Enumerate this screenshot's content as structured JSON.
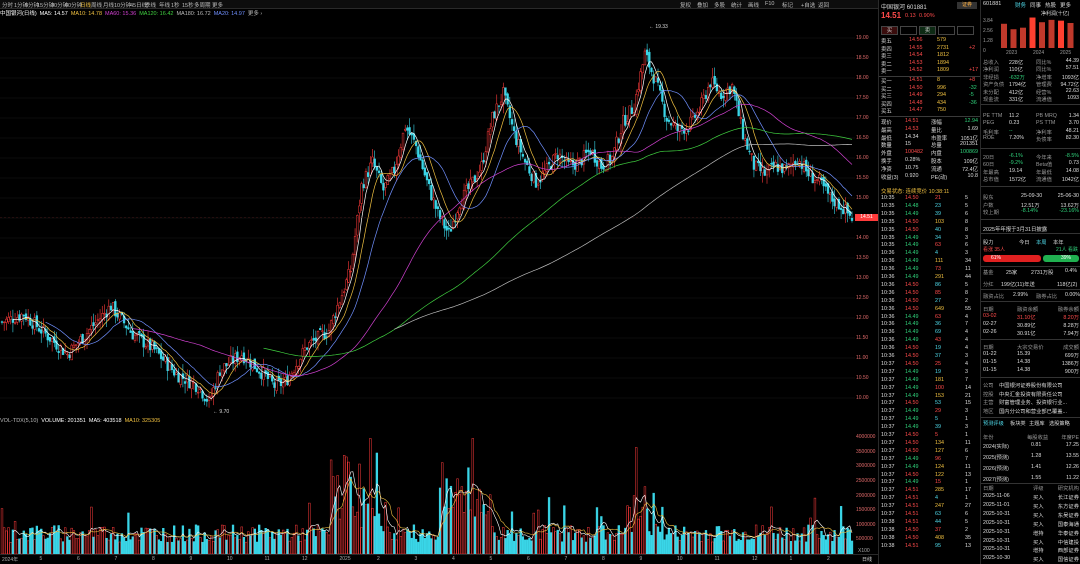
{
  "toolbar": {
    "periods": [
      {
        "label": "分时",
        "active": false
      },
      {
        "label": "1分钟",
        "active": false
      },
      {
        "label": "5分钟",
        "active": false
      },
      {
        "label": "15分钟",
        "active": false
      },
      {
        "label": "30分钟",
        "active": false
      },
      {
        "label": "60分钟",
        "active": false
      },
      {
        "label": "日线",
        "active": true
      },
      {
        "label": "周线",
        "active": false
      },
      {
        "label": "月线",
        "active": false
      },
      {
        "label": "10分钟",
        "active": false
      },
      {
        "label": "45日线",
        "active": false
      },
      {
        "label": "季线",
        "active": false
      },
      {
        "label": "年线",
        "active": false
      },
      {
        "label": "1秒",
        "active": false
      },
      {
        "label": "15秒",
        "active": false
      },
      {
        "label": "多周期",
        "active": false
      },
      {
        "label": "更多",
        "active": false
      }
    ],
    "tools": [
      "复权",
      "叠加",
      "多股",
      "统计",
      "画线",
      "F10",
      "标记",
      "+自选",
      "返回"
    ]
  },
  "ma_legend": {
    "title": "中国银河(日线)",
    "items": [
      {
        "text": "MA5: 14.57",
        "color": "#ffffff"
      },
      {
        "text": "MA10: 14.78",
        "color": "#f0c040"
      },
      {
        "text": "MA60: 15.36",
        "color": "#d040d0"
      },
      {
        "text": "MA120: 16.42",
        "color": "#40d040"
      },
      {
        "text": "MA180: 16.72",
        "color": "#bbbbbb"
      },
      {
        "text": "MA20: 14.97",
        "color": "#7090ff"
      },
      {
        "text": "更多 ›",
        "color": "#bbbbbb"
      }
    ]
  },
  "chart_data": [
    {
      "type": "candlestick",
      "title": "中国银河(日线)",
      "ylim": [
        9.5,
        19.5
      ],
      "y_ticks": [
        "18.00",
        "17.50",
        "17.00",
        "16.50",
        "16.00",
        "15.50",
        "15.00",
        "14.50",
        "14.00",
        "13.50",
        "13.00",
        "12.50",
        "12.00",
        "11.50",
        "11.00",
        "10.50",
        "10.00"
      ],
      "extra_ticks": [
        "19.00",
        "18.50"
      ],
      "x_labels": [
        "2024年",
        "5",
        "6",
        "7",
        "8",
        "9",
        "10",
        "11",
        "12",
        "2025",
        "2",
        "3",
        "4",
        "5",
        "6",
        "7",
        "8",
        "9",
        "10",
        "11",
        "12",
        "1",
        "2"
      ],
      "annotations": [
        {
          "text": "19.33"
        },
        {
          "text": "9.70"
        }
      ],
      "trend": [
        [
          0,
          11.9
        ],
        [
          10,
          12.1
        ],
        [
          20,
          11.6
        ],
        [
          30,
          11.1
        ],
        [
          40,
          11.7
        ],
        [
          50,
          12.3
        ],
        [
          60,
          11.6
        ],
        [
          70,
          11.2
        ],
        [
          80,
          10.6
        ],
        [
          90,
          10.3
        ],
        [
          95,
          9.9
        ],
        [
          100,
          10.7
        ],
        [
          110,
          11.1
        ],
        [
          120,
          10.6
        ],
        [
          125,
          10.3
        ],
        [
          130,
          10.4
        ],
        [
          140,
          11.3
        ],
        [
          150,
          11.7
        ],
        [
          160,
          13.2
        ],
        [
          165,
          15.3
        ],
        [
          170,
          15.9
        ],
        [
          175,
          15.2
        ],
        [
          180,
          15.7
        ],
        [
          185,
          16.8
        ],
        [
          190,
          16.3
        ],
        [
          195,
          15.4
        ],
        [
          200,
          14.6
        ],
        [
          205,
          14.1
        ],
        [
          210,
          14.9
        ],
        [
          215,
          15.3
        ],
        [
          220,
          15.8
        ],
        [
          225,
          17.0
        ],
        [
          230,
          17.6
        ],
        [
          235,
          16.6
        ],
        [
          240,
          15.9
        ],
        [
          245,
          15.4
        ],
        [
          250,
          15.7
        ],
        [
          255,
          16.1
        ],
        [
          260,
          15.8
        ],
        [
          265,
          15.9
        ],
        [
          270,
          16.2
        ],
        [
          275,
          15.8
        ],
        [
          280,
          16.0
        ],
        [
          285,
          16.9
        ],
        [
          290,
          17.3
        ],
        [
          295,
          18.6
        ],
        [
          300,
          17.9
        ],
        [
          305,
          17.0
        ],
        [
          310,
          16.7
        ],
        [
          315,
          16.8
        ],
        [
          320,
          17.2
        ],
        [
          325,
          17.9
        ],
        [
          330,
          17.6
        ],
        [
          335,
          17.8
        ],
        [
          340,
          16.6
        ],
        [
          345,
          15.8
        ],
        [
          350,
          15.6
        ],
        [
          355,
          15.8
        ],
        [
          360,
          15.7
        ],
        [
          365,
          16.0
        ],
        [
          370,
          15.6
        ],
        [
          375,
          15.4
        ],
        [
          380,
          15.0
        ],
        [
          385,
          14.8
        ],
        [
          390,
          14.5
        ]
      ],
      "last_value": 14.51,
      "series": [
        {
          "name": "MA5"
        },
        {
          "name": "MA10"
        },
        {
          "name": "MA20"
        },
        {
          "name": "MA60"
        },
        {
          "name": "MA120"
        },
        {
          "name": "MA180"
        }
      ]
    },
    {
      "type": "bar",
      "title": "VOL-TDX(5,10)",
      "ylim": [
        0,
        4000000
      ],
      "y_ticks": [
        "4000000",
        "3500000",
        "3000000",
        "2500000",
        "2000000",
        "1500000",
        "1000000",
        "500000"
      ],
      "unit": "X100",
      "values_note": "daily volume"
    }
  ],
  "vol_legend": {
    "items": [
      {
        "text": "VOL-TDX(5,10)",
        "color": "#bbbbbb"
      },
      {
        "text": "VOLUME: 201351",
        "color": "#ffffff"
      },
      {
        "text": "MA5: 403518",
        "color": "#ffffff"
      },
      {
        "text": "MA10: 325305",
        "color": "#f0c040"
      }
    ]
  },
  "quote": {
    "name": "中国银河",
    "code": "601881",
    "price": "14.51",
    "change": "0.13",
    "pct": "0.90%",
    "tag": "证券",
    "buy_btn": "买",
    "sell_btn": "卖",
    "sells": [
      {
        "l": "卖五",
        "p": "14.56",
        "v": "579",
        "d": ""
      },
      {
        "l": "卖四",
        "p": "14.55",
        "v": "2731",
        "d": "+2"
      },
      {
        "l": "卖三",
        "p": "14.54",
        "v": "1812",
        "d": ""
      },
      {
        "l": "卖二",
        "p": "14.53",
        "v": "1894",
        "d": ""
      },
      {
        "l": "卖一",
        "p": "14.52",
        "v": "1809",
        "d": "+17"
      }
    ],
    "buys": [
      {
        "l": "买一",
        "p": "14.51",
        "v": "8",
        "d": "+8"
      },
      {
        "l": "买二",
        "p": "14.50",
        "v": "996",
        "d": "-32"
      },
      {
        "l": "买三",
        "p": "14.49",
        "v": "294",
        "d": "-5"
      },
      {
        "l": "买四",
        "p": "14.48",
        "v": "434",
        "d": "-36"
      },
      {
        "l": "买五",
        "p": "14.47",
        "v": "750",
        "d": ""
      }
    ],
    "stats": [
      {
        "a": "现价",
        "av": "14.51",
        "b": "涨幅",
        "bv": "12.94"
      },
      {
        "a": "最高",
        "av": "14.53",
        "b": "量比",
        "bv": "1.69"
      },
      {
        "a": "最低",
        "av": "14.34",
        "b": "市盈率",
        "bv": "1051亿"
      },
      {
        "a": "数量",
        "av": "15",
        "b": "总量",
        "bv": "201351"
      },
      {
        "a": "外盘",
        "av": "100482",
        "b": "内盘",
        "bv": "100869"
      },
      {
        "a": "换手",
        "av": "0.28%",
        "b": "股本",
        "bv": "109亿"
      },
      {
        "a": "净资",
        "av": "10.75",
        "b": "流通",
        "bv": "72.4亿"
      },
      {
        "a": "收益(3)",
        "av": "0.920",
        "b": "PE(动)",
        "bv": "10.8"
      }
    ],
    "trade_title": "交易状态: 连续竞价 10:38:11",
    "ticks": [
      [
        "10:35",
        "14.50",
        "21",
        "5"
      ],
      [
        "10:35",
        "14.48",
        "23",
        "5"
      ],
      [
        "10:35",
        "14.49",
        "39",
        "6"
      ],
      [
        "10:35",
        "14.50",
        "103",
        "8"
      ],
      [
        "10:35",
        "14.50",
        "40",
        "8"
      ],
      [
        "10:35",
        "14.49",
        "34",
        "3"
      ],
      [
        "10:35",
        "14.49",
        "63",
        "6"
      ],
      [
        "10:36",
        "14.49",
        "4",
        "3"
      ],
      [
        "10:36",
        "14.49",
        "111",
        "34"
      ],
      [
        "10:36",
        "14.49",
        "73",
        "11"
      ],
      [
        "10:36",
        "14.49",
        "291",
        "44"
      ],
      [
        "10:36",
        "14.50",
        "86",
        "5"
      ],
      [
        "10:36",
        "14.50",
        "85",
        "8"
      ],
      [
        "10:36",
        "14.50",
        "27",
        "2"
      ],
      [
        "10:36",
        "14.50",
        "649",
        "55"
      ],
      [
        "10:36",
        "14.49",
        "63",
        "4"
      ],
      [
        "10:36",
        "14.49",
        "36",
        "7"
      ],
      [
        "10:36",
        "14.49",
        "69",
        "4"
      ],
      [
        "10:36",
        "14.49",
        "43",
        "4"
      ],
      [
        "10:36",
        "14.50",
        "19",
        "4"
      ],
      [
        "10:36",
        "14.50",
        "37",
        "3"
      ],
      [
        "10:37",
        "14.50",
        "25",
        "4"
      ],
      [
        "10:37",
        "14.49",
        "19",
        "3"
      ],
      [
        "10:37",
        "14.49",
        "181",
        "7"
      ],
      [
        "10:37",
        "14.49",
        "100",
        "14"
      ],
      [
        "10:37",
        "14.49",
        "153",
        "21"
      ],
      [
        "10:37",
        "14.50",
        "53",
        "15"
      ],
      [
        "10:37",
        "14.49",
        "29",
        "3"
      ],
      [
        "10:37",
        "14.49",
        "5",
        "1"
      ],
      [
        "10:37",
        "14.49",
        "39",
        "3"
      ],
      [
        "10:37",
        "14.50",
        "5",
        "1"
      ],
      [
        "10:37",
        "14.50",
        "134",
        "11"
      ],
      [
        "10:37",
        "14.50",
        "127",
        "6"
      ],
      [
        "10:37",
        "14.49",
        "96",
        "7"
      ],
      [
        "10:37",
        "14.49",
        "124",
        "11"
      ],
      [
        "10:37",
        "14.50",
        "122",
        "13"
      ],
      [
        "10:37",
        "14.49",
        "15",
        "1"
      ],
      [
        "10:37",
        "14.51",
        "285",
        "17"
      ],
      [
        "10:37",
        "14.51",
        "4",
        "1"
      ],
      [
        "10:37",
        "14.51",
        "247",
        "27"
      ],
      [
        "10:37",
        "14.51",
        "63",
        "6"
      ],
      [
        "10:38",
        "14.51",
        "44",
        "5"
      ],
      [
        "10:38",
        "14.50",
        "37",
        "2"
      ],
      [
        "10:38",
        "14.50",
        "408",
        "35"
      ],
      [
        "10:38",
        "14.51",
        "95",
        "13"
      ]
    ]
  },
  "info": {
    "code": "601881",
    "tabs": [
      "财务",
      "同事",
      "热股",
      "更多"
    ],
    "chart_title": "净利润(十亿)",
    "bar_years": [
      "2023",
      "2024",
      "2025"
    ],
    "bar_ticks": [
      "3.84",
      "2.56",
      "1.28",
      "0"
    ],
    "bar_values": [
      {
        "v": 3.1,
        "hl": false
      },
      {
        "v": 2.4,
        "hl": false
      },
      {
        "v": 2.6,
        "hl": false
      },
      {
        "v": 3.9,
        "hl": true
      },
      {
        "v": 3.3,
        "hl": false
      },
      {
        "v": 3.6,
        "hl": false
      },
      {
        "v": 3.5,
        "hl": true
      },
      {
        "v": 3.2,
        "hl": false
      }
    ],
    "fin": [
      [
        "总收入",
        "228亿",
        "同比%",
        "44.39"
      ],
      [
        "净利润",
        "110亿",
        "同比%",
        "57.51"
      ],
      [
        "非经损",
        "-632万",
        "净增率",
        "1093亿"
      ],
      [
        "资产负债",
        "1794亿",
        "管理费",
        "94.72亿"
      ],
      [
        "未分配",
        "412亿",
        "经营%",
        "22.63"
      ],
      [
        "现金流",
        "331亿",
        "流通值",
        "1093"
      ]
    ],
    "val": [
      [
        "PE TTM",
        "11.2",
        "PB MRQ",
        "1.34"
      ],
      [
        "PEG",
        "0.23",
        "PS TTM",
        "3.70"
      ],
      [
        "毛利率",
        "--",
        "净利率",
        "48.21"
      ],
      [
        "ROE",
        "7.20%",
        "负债率",
        "82.30"
      ]
    ],
    "perf": [
      [
        "20日",
        "-6.1%",
        "今年来",
        "-8.5%"
      ],
      [
        "60日",
        "-9.2%",
        "Beta值",
        "0.73"
      ],
      [
        "年最高",
        "19.14",
        "年最低",
        "14.08"
      ],
      [
        "总市值",
        "1572亿",
        "流通值",
        "1042亿"
      ]
    ],
    "holders_head": [
      "股东",
      "25-09-30",
      "25-06-30"
    ],
    "holders": [
      [
        "户数",
        "12.51万",
        "13.62万"
      ],
      [
        "较上期",
        "-8.14%",
        "-23.16%"
      ]
    ],
    "report_note": "2025年年报于3月31日披露",
    "consensus_tabs": [
      "股力",
      "今日",
      "本周",
      "本年"
    ],
    "bull_label": "看涨",
    "bull_count": "35人",
    "bear_label": "看跌",
    "bear_count": "21人",
    "bull_pct": "61%",
    "bear_pct": "39%",
    "fund_row": [
      "基金",
      "25家",
      "2731万股",
      "0.4%"
    ],
    "bonus_row": [
      "分红",
      "199亿(11)年送",
      "118亿(2)"
    ],
    "margin_row": [
      "融资占比",
      "2.99%",
      "融券占比",
      "0.00%"
    ],
    "margin_head": [
      "日期",
      "融资余额",
      "融券余额"
    ],
    "margin": [
      [
        "03-02",
        "31.10亿",
        "8.20万"
      ],
      [
        "02-27",
        "30.89亿",
        "8.28万"
      ],
      [
        "02-26",
        "30.91亿",
        "7.94万"
      ]
    ],
    "block_head": [
      "日期",
      "大宗交易价",
      "成交额"
    ],
    "block": [
      [
        "01-22",
        "15.39",
        "699万"
      ],
      [
        "01-15",
        "14.38",
        "1386万"
      ],
      [
        "01-15",
        "14.38",
        "900万"
      ]
    ],
    "company": [
      [
        "公司",
        "中国银河证券股份有限公司"
      ],
      [
        "控股",
        "中央汇金投资有限责任公司"
      ],
      [
        "主营",
        "财富管理业务、投资银行业..."
      ],
      [
        "地区",
        "国内分公司和营业部已覆盖..."
      ]
    ],
    "forecast_tabs": [
      "预测评级",
      "板块类",
      "主题库",
      "选股策略"
    ],
    "forecast_head": [
      "年份",
      "每股收益",
      "年度PE"
    ],
    "forecast": [
      [
        "2024(实际)",
        "0.81",
        "17.25"
      ],
      [
        "2025(预测)",
        "1.28",
        "13.55"
      ],
      [
        "2026(预测)",
        "1.41",
        "12.26"
      ],
      [
        "2027(预测)",
        "1.55",
        "11.22"
      ]
    ],
    "rating_head": [
      "日期",
      "评级",
      "研究机构"
    ],
    "ratings": [
      [
        "2025-11-06",
        "买入",
        "长江证券"
      ],
      [
        "2025-11-01",
        "买入",
        "东方证券"
      ],
      [
        "2025-10-31",
        "买入",
        "东吴证券"
      ],
      [
        "2025-10-31",
        "买入",
        "国泰海通"
      ],
      [
        "2025-10-31",
        "增持",
        "华泰证券"
      ],
      [
        "2025-10-31",
        "买入",
        "中信建投"
      ],
      [
        "2025-10-31",
        "增持",
        "西部证券"
      ],
      [
        "2025-10-30",
        "买入",
        "国信证券"
      ]
    ]
  },
  "status": {
    "label": "日线"
  }
}
